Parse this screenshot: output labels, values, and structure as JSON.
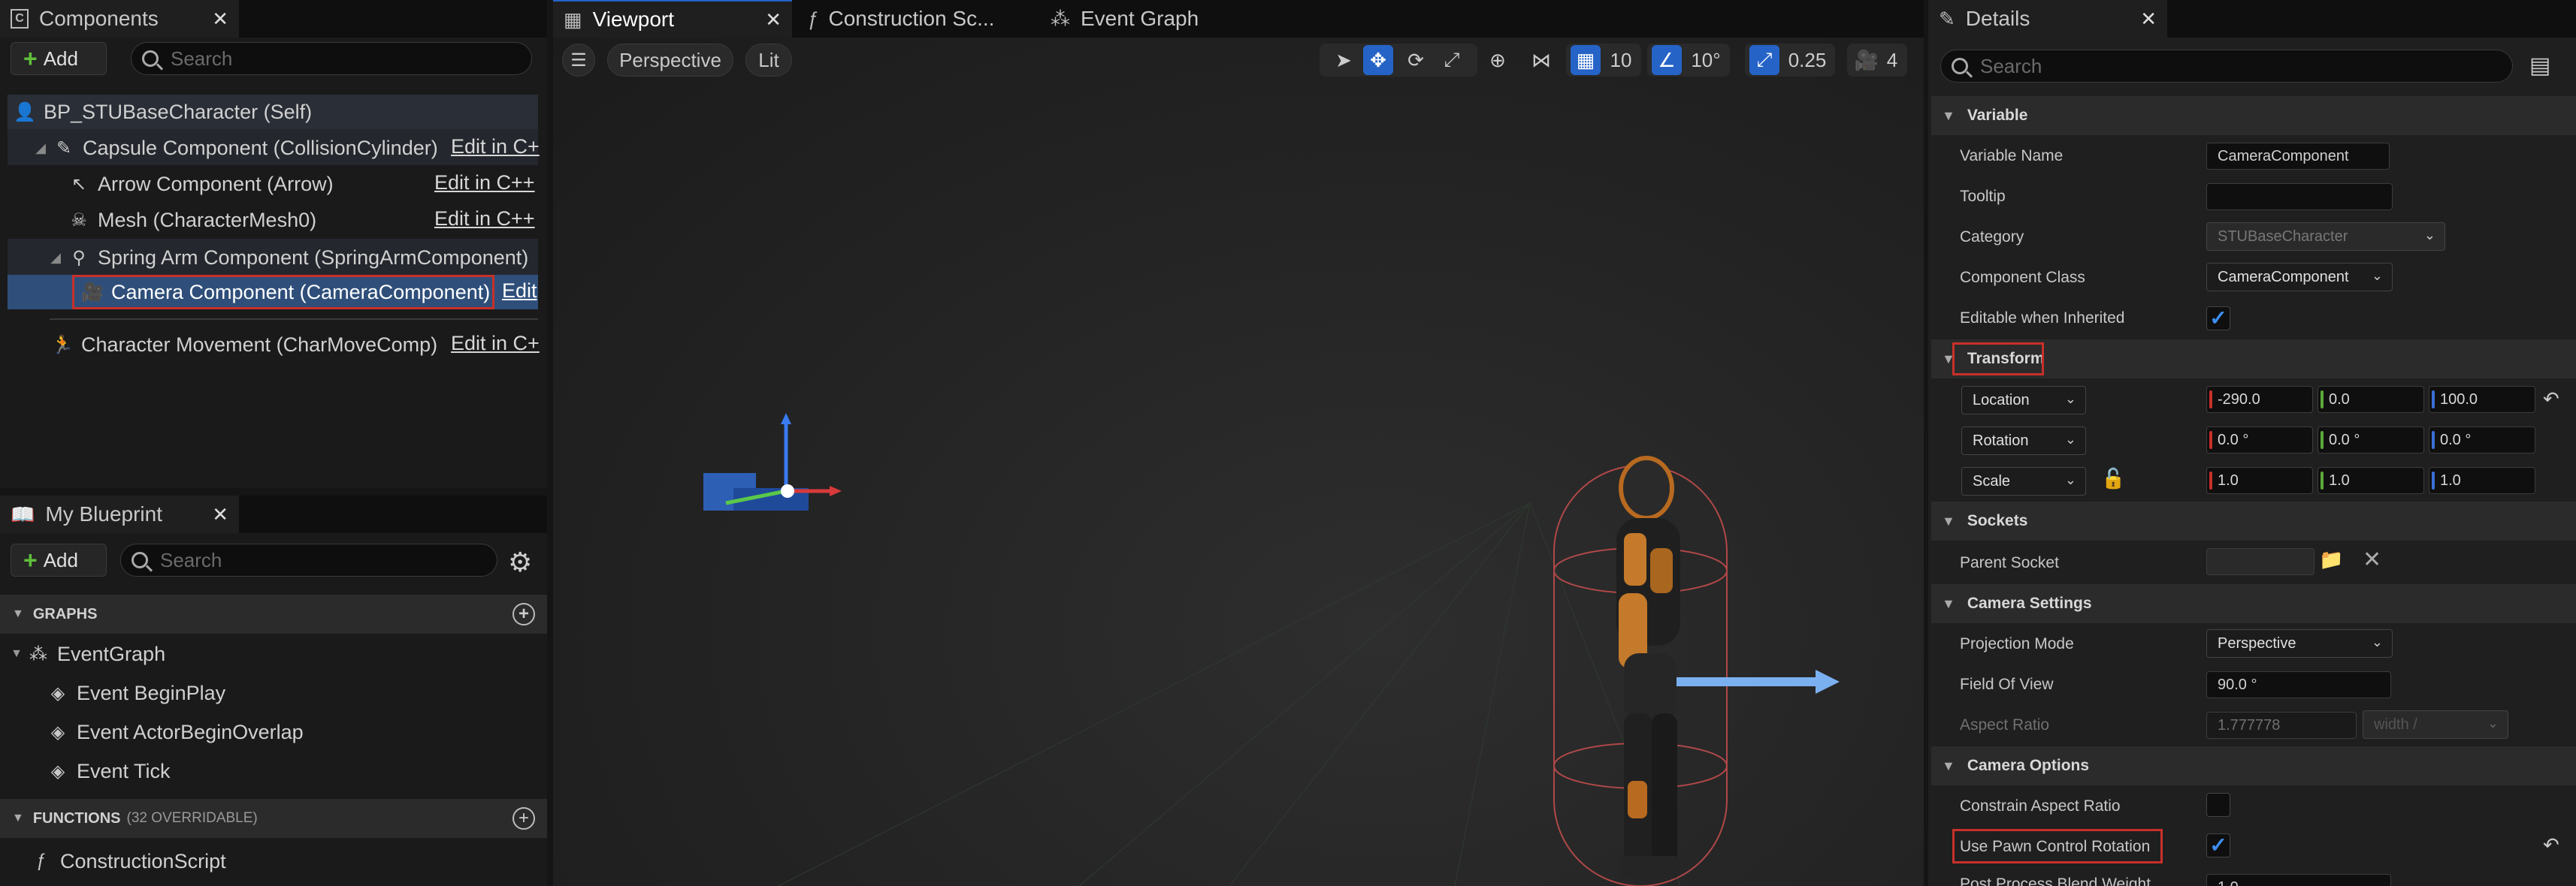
{
  "tabs": {
    "components": "Components",
    "viewport": "Viewport",
    "construction": "Construction Sc...",
    "event_graph": "Event Graph",
    "details": "Details",
    "my_blueprint": "My Blueprint"
  },
  "components_panel": {
    "add_label": "Add",
    "search_placeholder": "Search",
    "tree": {
      "self": "BP_STUBaseCharacter (Self)",
      "capsule": "Capsule Component (CollisionCylinder)",
      "arrow": "Arrow Component (Arrow)",
      "mesh": "Mesh (CharacterMesh0)",
      "spring_arm": "Spring Arm Component (SpringArmComponent)",
      "camera": "Camera Component (CameraComponent)",
      "movement": "Character Movement (CharMoveComp)"
    },
    "edit_links": {
      "capsule": "Edit in C+",
      "arrow": "Edit in C++",
      "mesh": "Edit in C++",
      "camera": "Edit",
      "movement": "Edit in C+"
    }
  },
  "my_blueprint": {
    "add_label": "Add",
    "search_placeholder": "Search",
    "graphs_header": "GRAPHS",
    "event_graph": "EventGraph",
    "events": [
      "Event BeginPlay",
      "Event ActorBeginOverlap",
      "Event Tick"
    ],
    "functions_header": "FUNCTIONS",
    "functions_note": "(32 OVERRIDABLE)",
    "construction_script": "ConstructionScript"
  },
  "viewport": {
    "perspective": "Perspective",
    "lit": "Lit",
    "grid_snap": "10",
    "rotation_snap": "10°",
    "scale_snap": "0.25",
    "camera_speed": "4"
  },
  "details": {
    "search_placeholder": "Search",
    "sections": {
      "variable": "Variable",
      "transform": "Transform",
      "sockets": "Sockets",
      "camera_settings": "Camera Settings",
      "camera_options": "Camera Options"
    },
    "variable_name_label": "Variable Name",
    "variable_name": "CameraComponent",
    "tooltip_label": "Tooltip",
    "tooltip_value": "",
    "category_label": "Category",
    "category_value": "STUBaseCharacter",
    "component_class_label": "Component Class",
    "component_class_value": "CameraComponent",
    "editable_label": "Editable when Inherited",
    "location_label": "Location",
    "location": [
      "-290.0",
      "0.0",
      "100.0"
    ],
    "rotation_label": "Rotation",
    "rotation": [
      "0.0 °",
      "0.0 °",
      "0.0 °"
    ],
    "scale_label": "Scale",
    "scale": [
      "1.0",
      "1.0",
      "1.0"
    ],
    "parent_socket_label": "Parent Socket",
    "projection_mode_label": "Projection Mode",
    "projection_mode": "Perspective",
    "fov_label": "Field Of View",
    "fov": "90.0 °",
    "aspect_ratio_label": "Aspect Ratio",
    "aspect_ratio": "1.777778",
    "aspect_ratio_axis": "width / ",
    "constrain_label": "Constrain Aspect Ratio",
    "pawn_rotation_label": "Use Pawn Control Rotation",
    "post_process_label": "Post Process Blend Weight",
    "post_process_value": "1.0"
  },
  "colors": {
    "accent_blue": "#2563c7",
    "highlight_red": "#c8302a",
    "selection": "#2f4f7a"
  }
}
